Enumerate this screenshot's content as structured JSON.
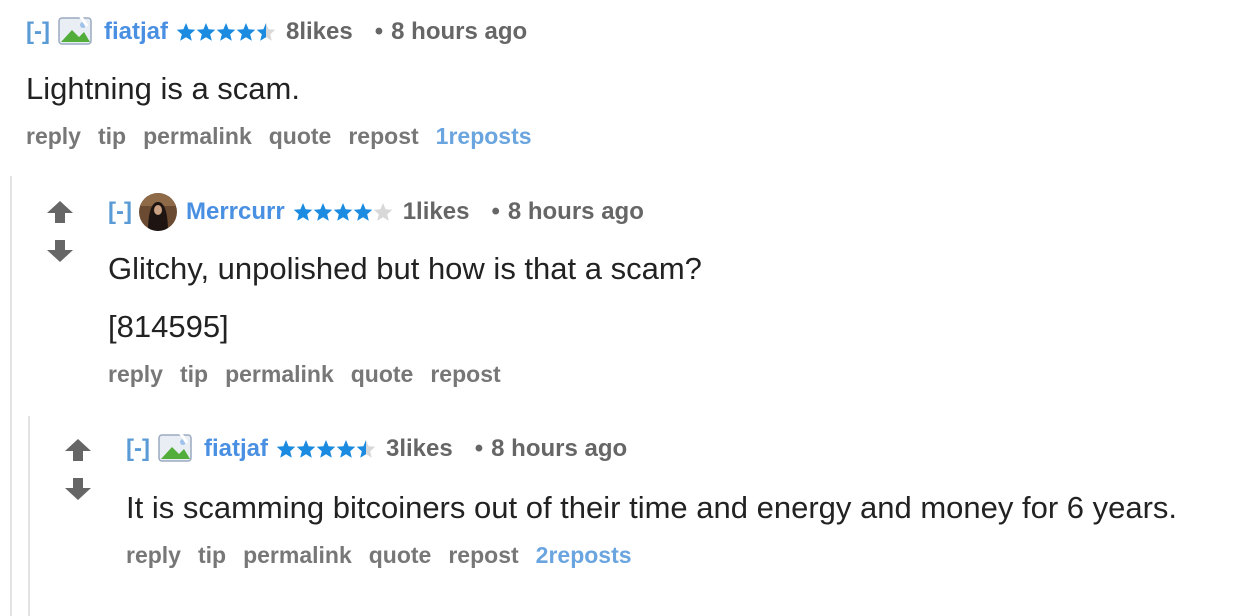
{
  "icons": {
    "upvote": "arrow-up-icon",
    "downvote": "arrow-down-icon",
    "avatar_placeholder": "broken-image-icon",
    "star": "star-icon"
  },
  "colors": {
    "link": "#4a90e2",
    "star": "#1a8be0",
    "star_empty": "#d8d8d8",
    "muted": "#777777"
  },
  "comments": [
    {
      "toggle": "[-]",
      "author": "fiatjaf",
      "rating": 4.5,
      "likes": "8likes",
      "separator": "•",
      "time": "8 hours ago",
      "body": "Lightning is a scam.",
      "actions": {
        "reply": "reply",
        "tip": "tip",
        "permalink": "permalink",
        "quote": "quote",
        "repost": "repost",
        "reposts": "1reposts"
      }
    },
    {
      "toggle": "[-]",
      "author": "Merrcurr",
      "rating": 4,
      "likes": "1likes",
      "separator": "•",
      "time": "8 hours ago",
      "body": "Glitchy, unpolished but how is that a scam?",
      "body_extra": "[814595]",
      "actions": {
        "reply": "reply",
        "tip": "tip",
        "permalink": "permalink",
        "quote": "quote",
        "repost": "repost"
      }
    },
    {
      "toggle": "[-]",
      "author": "fiatjaf",
      "rating": 4.5,
      "likes": "3likes",
      "separator": "•",
      "time": "8 hours ago",
      "body": "It is scamming bitcoiners out of their time and energy and money for 6 years.",
      "actions": {
        "reply": "reply",
        "tip": "tip",
        "permalink": "permalink",
        "quote": "quote",
        "repost": "repost",
        "reposts": "2reposts"
      }
    }
  ]
}
